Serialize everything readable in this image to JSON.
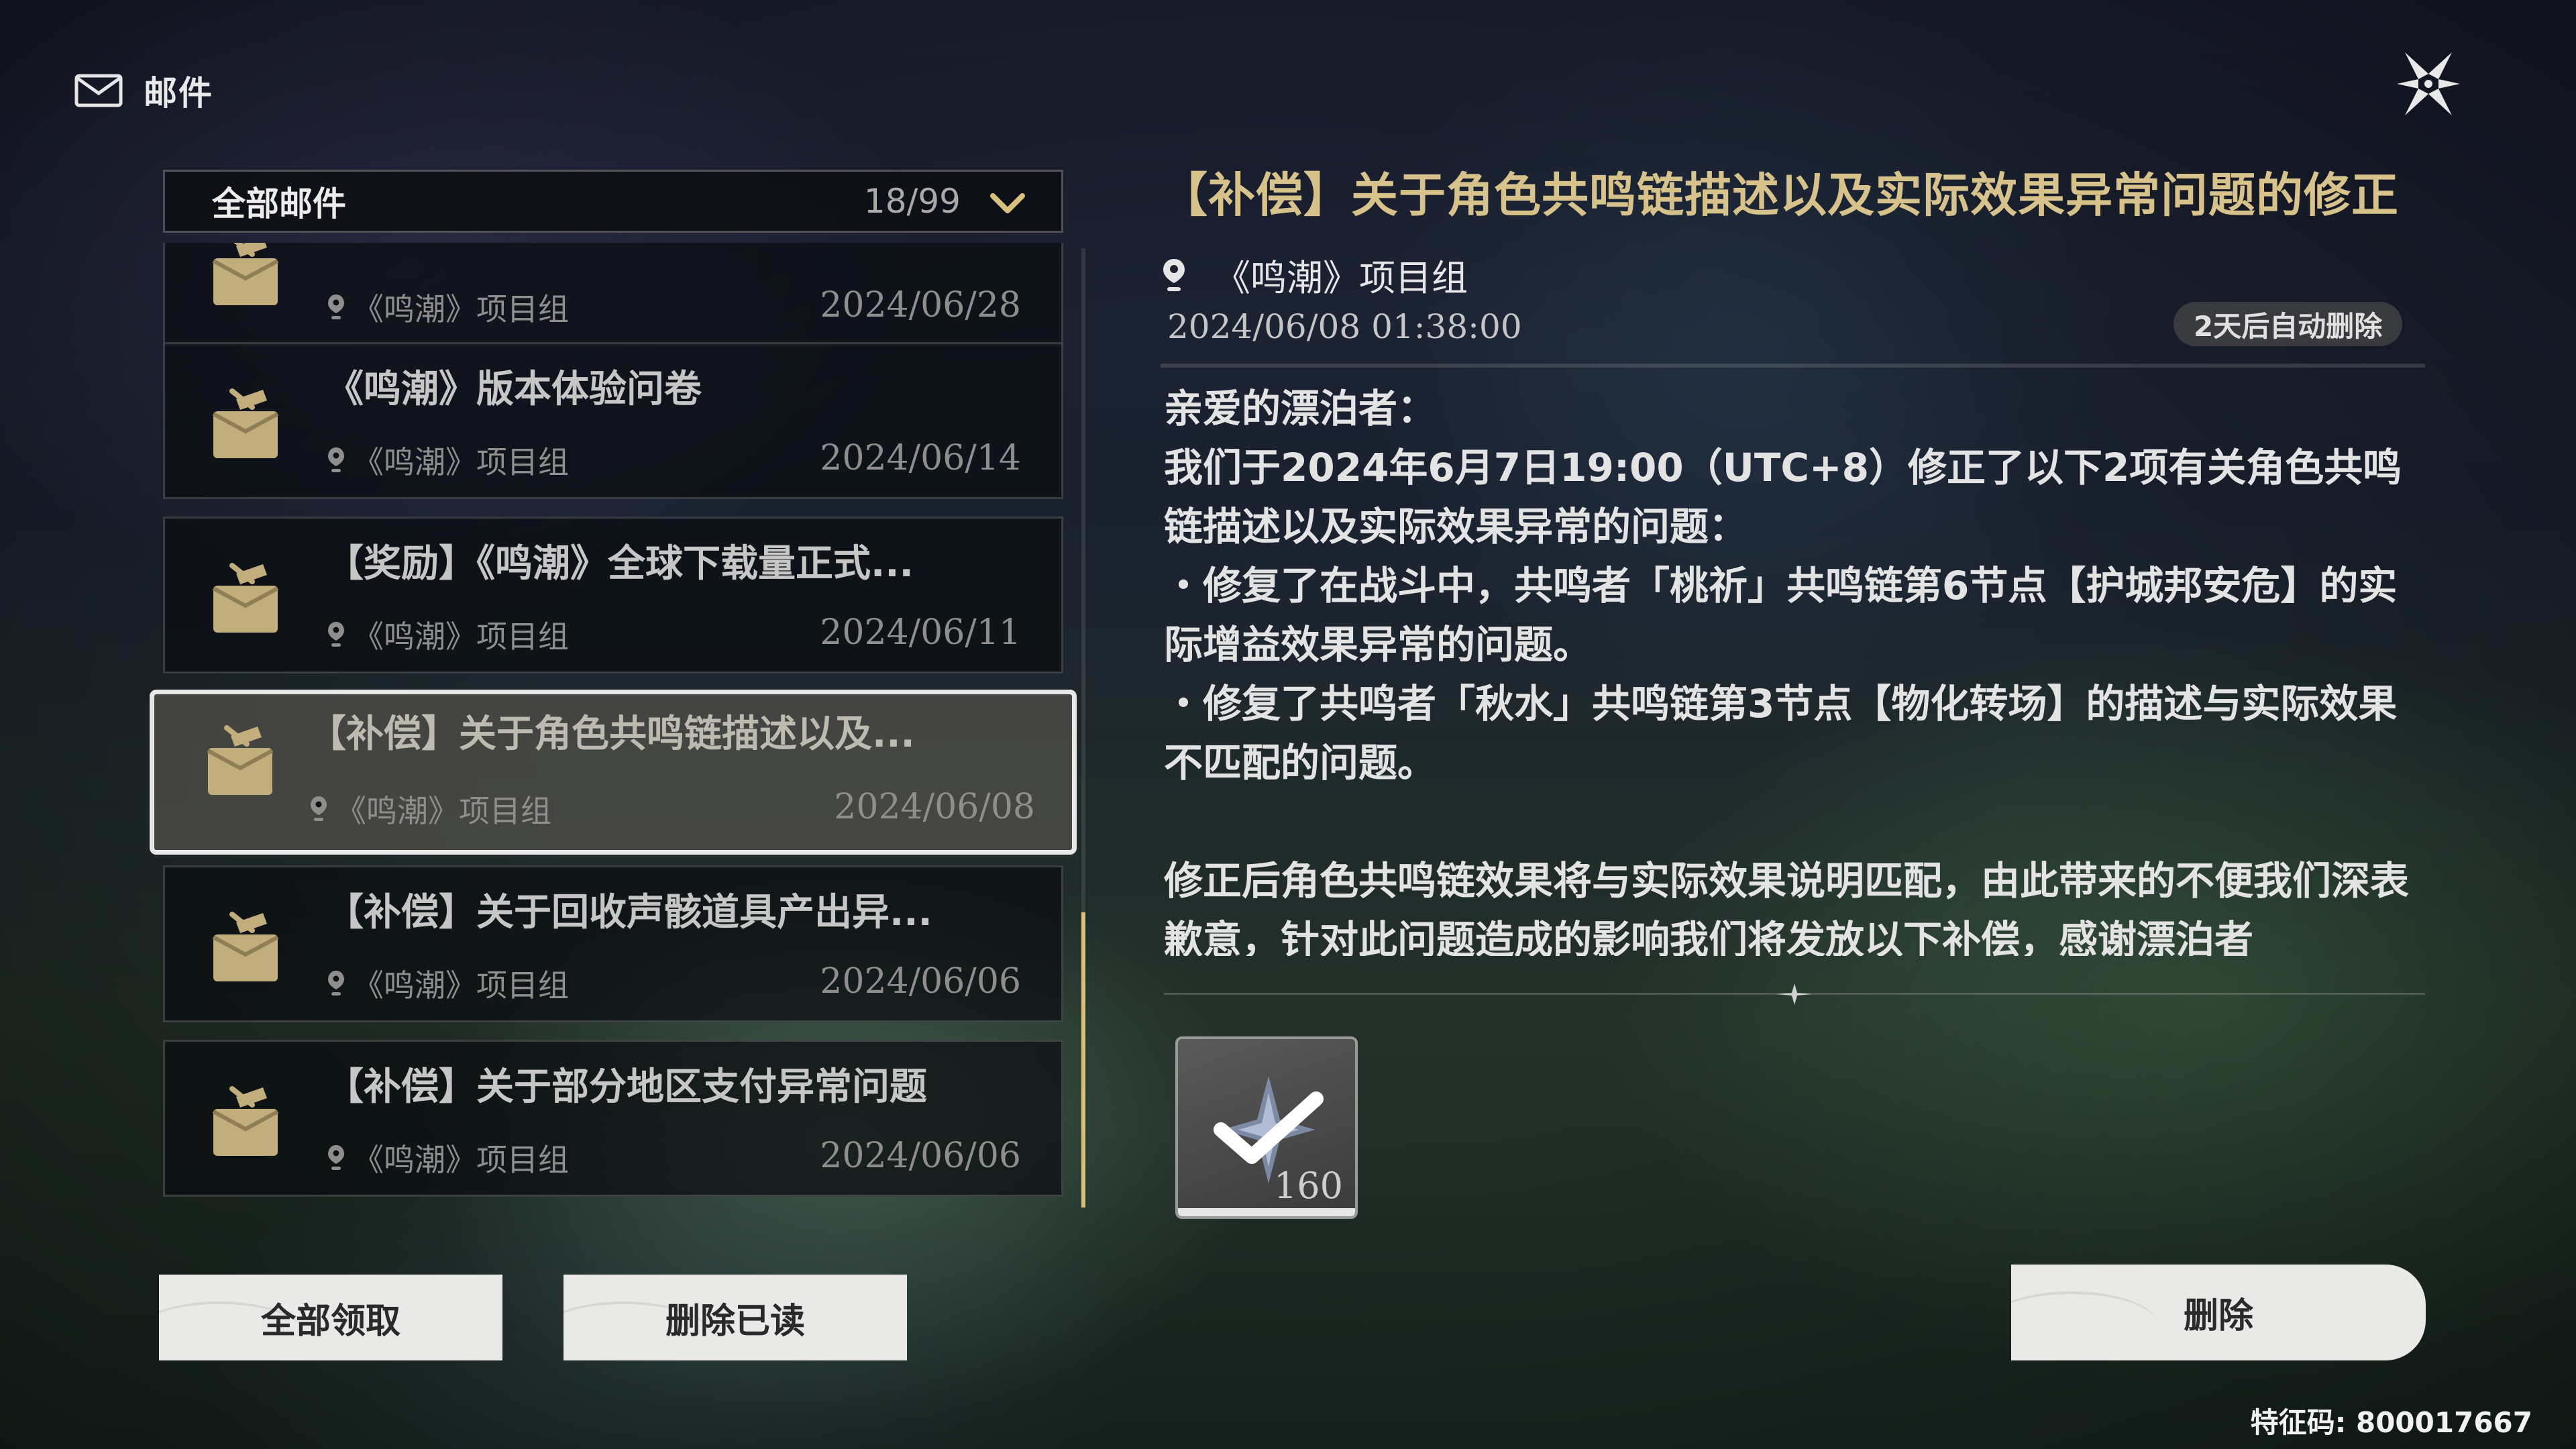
{
  "header": {
    "title": "邮件"
  },
  "filter": {
    "label": "全部邮件",
    "count": "18/99"
  },
  "mails": [
    {
      "subject": "",
      "sender": "《鸣潮》项目组",
      "date": "2024/06/28"
    },
    {
      "subject": "《鸣潮》版本体验问卷",
      "sender": "《鸣潮》项目组",
      "date": "2024/06/14"
    },
    {
      "subject": "【奖励】《鸣潮》全球下载量正式...",
      "sender": "《鸣潮》项目组",
      "date": "2024/06/11"
    },
    {
      "subject": "【补偿】关于角色共鸣链描述以及...",
      "sender": "《鸣潮》项目组",
      "date": "2024/06/08"
    },
    {
      "subject": "【补偿】关于回收声骸道具产出异...",
      "sender": "《鸣潮》项目组",
      "date": "2024/06/06"
    },
    {
      "subject": "【补偿】关于部分地区支付异常问题",
      "sender": "《鸣潮》项目组",
      "date": "2024/06/06"
    }
  ],
  "scroll_position": 0.7,
  "buttons": {
    "claim_all": "全部领取",
    "delete_read": "删除已读",
    "delete": "删除"
  },
  "detail": {
    "title": "【补偿】关于角色共鸣链描述以及实际效果异常问题的修正",
    "sender": "《鸣潮》项目组",
    "time": "2024/06/08 01:38:00",
    "auto_delete": "2天后自动删除",
    "body": {
      "greeting": "亲爱的漂泊者：",
      "line1": "我们于2024年6月7日19:00（UTC+8）修正了以下2项有关角色共鸣链描述以及实际效果异常的问题：",
      "item1": "・修复了在战斗中，共鸣者「桃祈」共鸣链第6节点【护城邦安危】的实际增益效果异常的问题。",
      "item2": "・修复了共鸣者「秋水」共鸣链第3节点【物化转场】的描述与实际效果不匹配的问题。",
      "para2": "修正后角色共鸣链效果将与实际效果说明匹配，由此带来的不便我们深表歉意，针对此问题造成的影响我们将发放以下补偿，感谢漂泊者"
    },
    "reward": {
      "quantity": "160",
      "icon": "astrite-icon",
      "claimed": true
    }
  },
  "feature_code": "特征码: 800017667",
  "colors": {
    "accent_gold": "#d7c28c",
    "scroll_thumb": "#d9c07c"
  }
}
